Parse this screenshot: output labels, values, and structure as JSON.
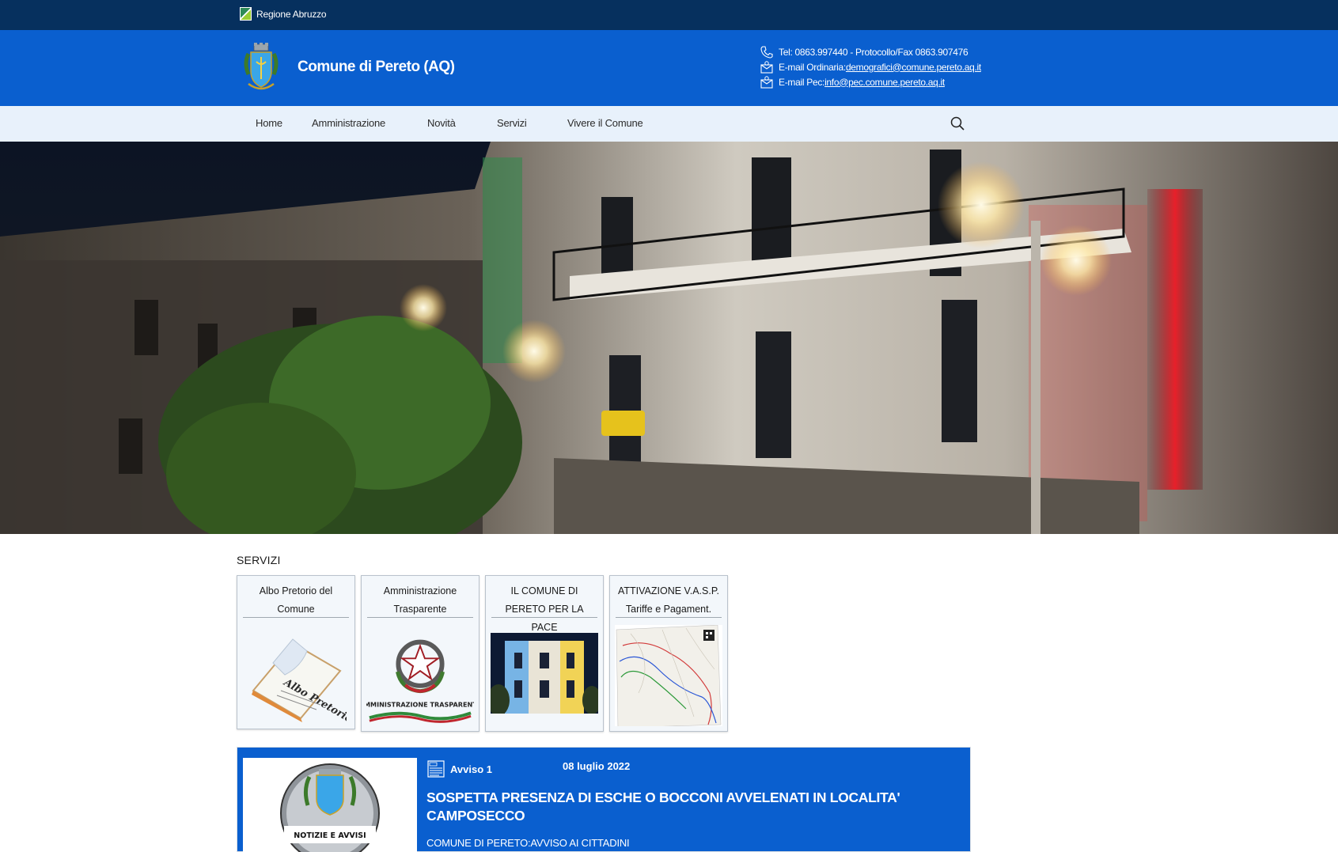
{
  "top_bar": {
    "region_label": "Regione Abruzzo"
  },
  "header": {
    "site_title": "Comune di Pereto (AQ)",
    "contacts": {
      "phone": "Tel: 0863.997440 - Protocollo/Fax 0863.907476",
      "email_label": "E-mail Ordinaria: ",
      "email_value": "demografici@comune.pereto.aq.it",
      "pec_label": "E-mail Pec: ",
      "pec_value": "info@pec.comune.pereto.aq.it"
    }
  },
  "nav": {
    "items": [
      {
        "label": "Home"
      },
      {
        "label": "Amministrazione"
      },
      {
        "label": "Novità"
      },
      {
        "label": "Servizi"
      },
      {
        "label": "Vivere il Comune"
      }
    ]
  },
  "services": {
    "section_title": "SERVIZI",
    "cards": [
      {
        "title": "Albo Pretorio del Comune",
        "image_text": "Albo Pretorio"
      },
      {
        "title": "Amministrazione Trasparente",
        "image_text": "AMMINISTRAZIONE TRASPARENTE"
      },
      {
        "title": "IL COMUNE DI PERETO PER LA PACE"
      },
      {
        "title": "ATTIVAZIONE V.A.S.P. Tariffe e Pagament."
      }
    ]
  },
  "news": {
    "category": "Avviso 1",
    "date": "08 luglio 2022",
    "headline": "SOSPETTA PRESENZA DI ESCHE O BOCCONI AVVELENATI IN LOCALITA' CAMPOSECCO",
    "subtitle": "COMUNE DI PERETO:AVVISO AI CITTADINI",
    "image_label": "NOTIZIE E AVVISI"
  },
  "colors": {
    "top_bar": "#06305e",
    "header": "#0a5fcf",
    "nav": "#e8f1fb",
    "news_card": "#0a5fcf"
  }
}
